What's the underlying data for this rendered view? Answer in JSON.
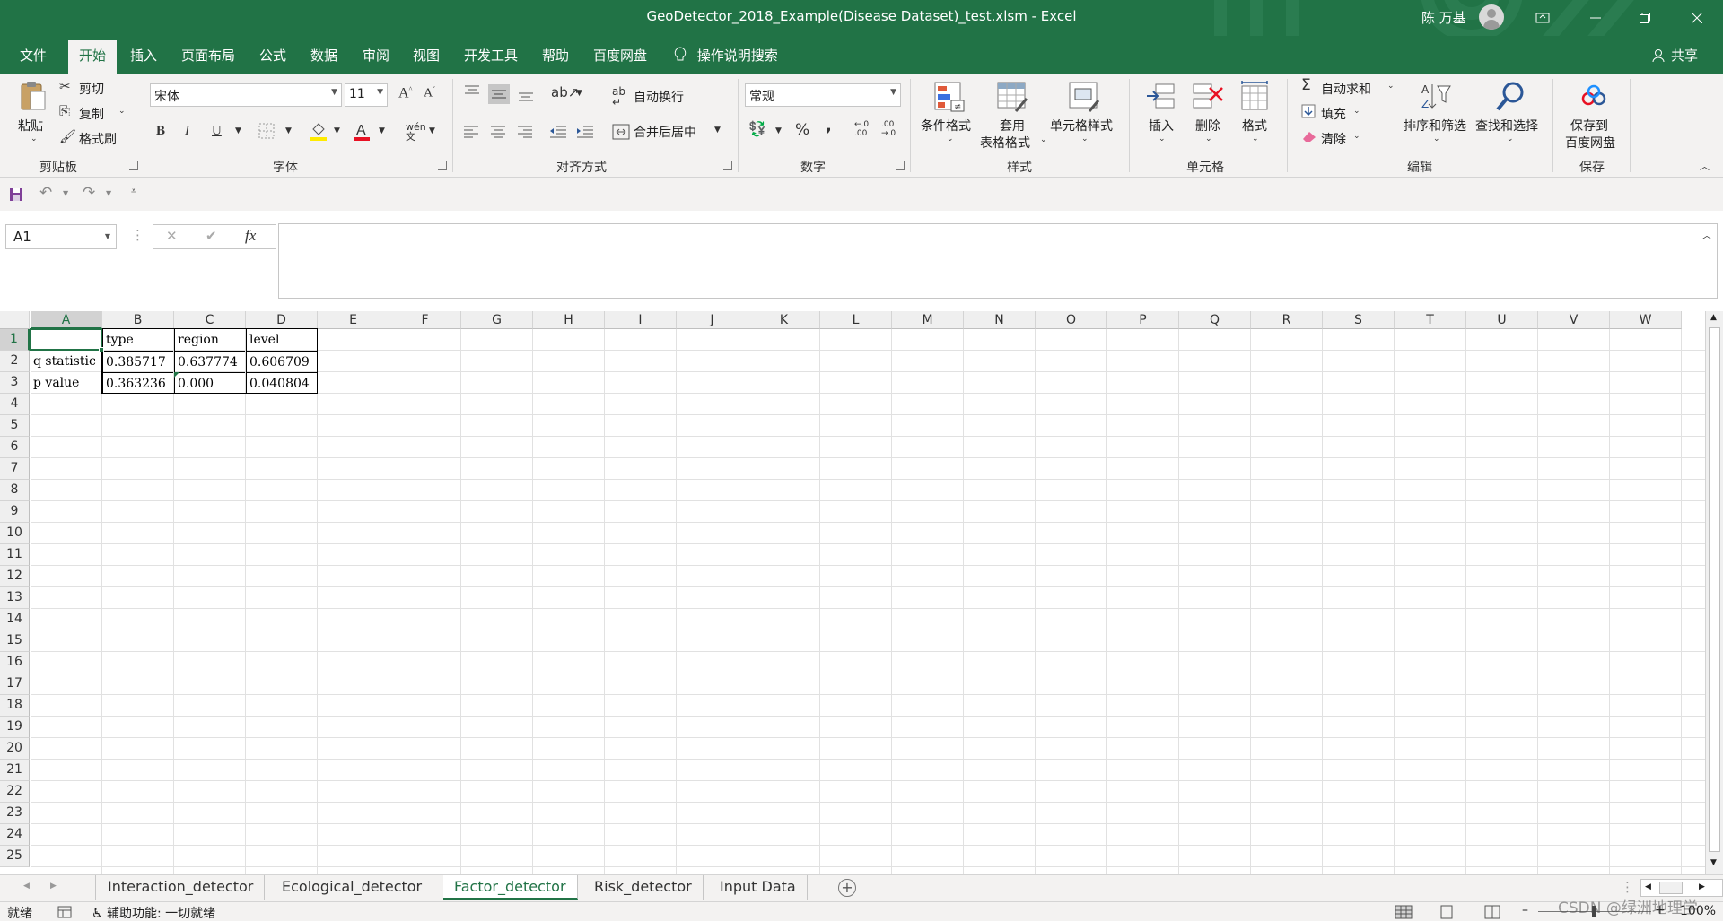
{
  "window": {
    "title": "GeoDetector_2018_Example(Disease Dataset)_test.xlsm  -  Excel",
    "user": "陈 万基"
  },
  "menu": {
    "tabs": [
      "文件",
      "开始",
      "插入",
      "页面布局",
      "公式",
      "数据",
      "审阅",
      "视图",
      "开发工具",
      "帮助",
      "百度网盘"
    ],
    "active": "开始",
    "tell_me": "操作说明搜索",
    "share": "共享"
  },
  "ribbon": {
    "clipboard": {
      "paste": "粘贴",
      "cut": "剪切",
      "copy": "复制",
      "format_painter": "格式刷",
      "label": "剪贴板"
    },
    "font": {
      "name": "宋体",
      "size": "11",
      "label": "字体",
      "bold": "B",
      "italic": "I",
      "underline": "U",
      "phonetic": "wén"
    },
    "alignment": {
      "wrap": "自动换行",
      "merge": "合并后居中",
      "label": "对齐方式"
    },
    "number": {
      "format": "常规",
      "percent": "%",
      "comma": ",",
      "inc_decimal": ".00",
      "dec_decimal": ".00",
      "label": "数字"
    },
    "styles": {
      "conditional": "条件格式",
      "table_top": "套用",
      "table_bottom": "表格格式",
      "cell_styles": "单元格样式",
      "label": "样式"
    },
    "cells": {
      "insert": "插入",
      "delete": "删除",
      "format": "格式",
      "label": "单元格"
    },
    "editing": {
      "autosum": "自动求和",
      "fill": "填充",
      "clear": "清除",
      "sort": "排序和筛选",
      "find": "查找和选择",
      "label": "编辑"
    },
    "save": {
      "line1": "保存到",
      "line2": "百度网盘",
      "label": "保存"
    }
  },
  "formula_bar": {
    "name_box": "A1",
    "fx": "fx",
    "content": ""
  },
  "grid": {
    "columns": [
      "A",
      "B",
      "C",
      "D",
      "E",
      "F",
      "G",
      "H",
      "I",
      "J",
      "K",
      "L",
      "M",
      "N",
      "O",
      "P",
      "Q",
      "R",
      "S",
      "T",
      "U",
      "V",
      "W"
    ],
    "rows": [
      "1",
      "2",
      "3",
      "4",
      "5",
      "6",
      "7",
      "8",
      "9",
      "10",
      "11",
      "12",
      "13",
      "14",
      "15",
      "16",
      "17",
      "18",
      "19",
      "20",
      "21",
      "22",
      "23",
      "24",
      "25"
    ],
    "selected_cell": "A1",
    "cells": [
      [
        "",
        "type",
        "region",
        "level"
      ],
      [
        "q statistic",
        "0.385717",
        "0.637774",
        "0.606709"
      ],
      [
        "p value",
        "0.363236",
        "0.000",
        "0.040804"
      ]
    ]
  },
  "sheets": {
    "tabs": [
      "Interaction_detector",
      "Ecological_detector",
      "Factor_detector",
      "Risk_detector",
      "Input Data"
    ],
    "active": "Factor_detector"
  },
  "status": {
    "ready": "就绪",
    "accessibility": "辅助功能: 一切就绪",
    "zoom": "100%",
    "watermark": "CSDN @绿洲地理学"
  },
  "colors": {
    "excel_green": "#217346",
    "ribbon_bg": "#f3f2f1"
  }
}
